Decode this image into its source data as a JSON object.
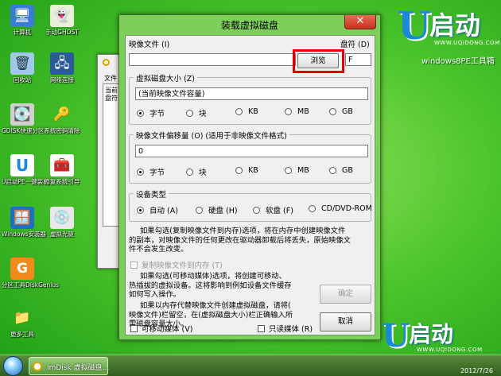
{
  "desktop": {
    "icons": [
      {
        "label": "计算机",
        "icon": "computer-icon",
        "glyph": "🖥"
      },
      {
        "label": "手动GHOST",
        "icon": "ghost-icon",
        "glyph": "👻"
      },
      {
        "label": "回收站",
        "icon": "recycle-bin-icon",
        "glyph": "🗑"
      },
      {
        "label": "网络连接",
        "icon": "network-icon",
        "glyph": "🖧"
      },
      {
        "label": "GDISK快速分区",
        "icon": "gdisk-icon",
        "glyph": "💽"
      },
      {
        "label": "系统密码清除",
        "icon": "key-icon",
        "glyph": "🔑"
      },
      {
        "label": "U启动PE一键装机",
        "icon": "u-install-icon",
        "glyph": "U"
      },
      {
        "label": "修复系统引导",
        "icon": "repair-icon",
        "glyph": "🧰"
      },
      {
        "label": "Windows安装器",
        "icon": "windows-installer-icon",
        "glyph": "🪟"
      },
      {
        "label": "虚拟光驱",
        "icon": "virtual-drive-icon",
        "glyph": "💿"
      },
      {
        "label": "分区工具DiskGenius",
        "icon": "diskgenius-icon",
        "glyph": "G"
      },
      {
        "label": "更多工具",
        "icon": "folder-icon",
        "glyph": "📁"
      }
    ]
  },
  "brand": {
    "logo_u": "U",
    "logo_text": "启动",
    "url": "WWW.UQIDONG.COM",
    "pe_label": "windows8PE工具箱"
  },
  "bg_window": {
    "label1": "文件",
    "label2": "当前",
    "label3": "盘符"
  },
  "dialog": {
    "title": "装载虚拟磁盘",
    "close_glyph": "✕",
    "image_file_label": "映像文件 (I)",
    "image_file_value": "",
    "browse_label": "浏览",
    "drive_label": "盘符 (D)",
    "drive_value": "F",
    "size_group": {
      "title": "虚拟磁盘大小 (Z)",
      "value": "(当前映像文件容量)",
      "units": [
        {
          "label": "字节",
          "selected": true
        },
        {
          "label": "块",
          "selected": false
        },
        {
          "label": "KB",
          "selected": false
        },
        {
          "label": "MB",
          "selected": false
        },
        {
          "label": "GB",
          "selected": false
        }
      ]
    },
    "offset_group": {
      "title": "映像文件偏移量 (O) (适用于非映像文件格式)",
      "value": "0",
      "units": [
        {
          "label": "字节",
          "selected": true
        },
        {
          "label": "块",
          "selected": false
        },
        {
          "label": "KB",
          "selected": false
        },
        {
          "label": "MB",
          "selected": false
        },
        {
          "label": "GB",
          "selected": false
        }
      ]
    },
    "device_group": {
      "title": "设备类型",
      "types": [
        {
          "label": "自动 (A)",
          "selected": true
        },
        {
          "label": "硬盘 (H)",
          "selected": false
        },
        {
          "label": "软盘 (F)",
          "selected": false
        },
        {
          "label": "CD/DVD-ROM",
          "selected": false
        }
      ]
    },
    "para1": [
      "如果勾选(复制映像文件到内存)选项，将在内存中创建映像文件",
      "的副本，对映像文件的任何更改在驱动器卸载后将丢失，原始映像文",
      "件不会发生改变。"
    ],
    "copy_to_memory_label": "复制映像文件到内存 (T)",
    "para2": [
      "如果勾选(可移动媒体)选项，将创建可移动、",
      "热插拔的虚拟设备。这将影响到例如设备文件缓存",
      "如何写入操作。"
    ],
    "para3": [
      "如果以内存代替映像文件创建虚拟磁盘，请将(",
      "映像文件)栏留空，在(虚拟磁盘大小)栏正确输入所",
      "需磁盘容量大小。"
    ],
    "ok_label": "确定",
    "cancel_label": "取消",
    "removable_label": "可移动媒体 (V)",
    "readonly_label": "只读媒体 (R)"
  },
  "taskbar": {
    "task_label": "ImDisk 虚拟磁盘...",
    "date": "2012/7/26"
  }
}
